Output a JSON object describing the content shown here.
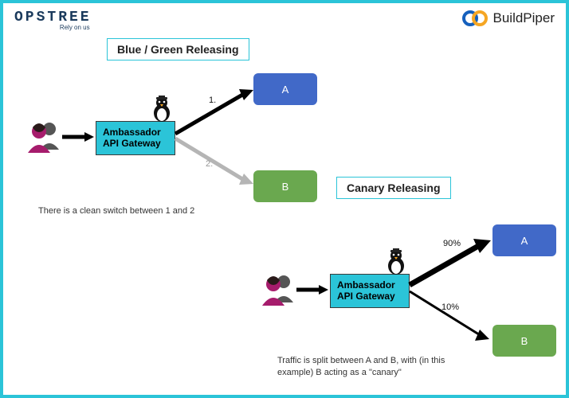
{
  "header": {
    "opstree_main": "OPSTREE",
    "opstree_sub": "Rely on us",
    "buildpiper": "BuildPiper"
  },
  "diagrams": {
    "bluegreen": {
      "title": "Blue / Green Releasing",
      "gateway": "Ambassador API Gateway",
      "box_a": "A",
      "box_b": "B",
      "label_top": "1.",
      "label_bottom": "2.",
      "caption": "There is a clean switch between 1 and 2"
    },
    "canary": {
      "title": "Canary Releasing",
      "gateway": "Ambassador API Gateway",
      "box_a": "A",
      "box_b": "B",
      "label_top": "90%",
      "label_bottom": "10%",
      "caption": "Traffic is split between A and B, with (in this example) B  acting as a \"canary\""
    }
  },
  "icons": {
    "users": "users-icon",
    "penguin": "penguin-icon",
    "bp_logo": "buildpiper-logo"
  }
}
